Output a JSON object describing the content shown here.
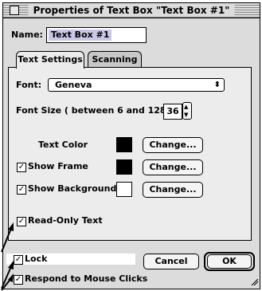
{
  "dialog": {
    "title": "Properties of Text Box \"Text Box #1\"",
    "name_label": "Name:",
    "name_value": "Text Box #1"
  },
  "tabs": [
    {
      "label": "Text Settings",
      "active": true
    },
    {
      "label": "Scanning",
      "active": false
    }
  ],
  "text_settings": {
    "font_label": "Font:",
    "font_value": "Geneva",
    "font_size_label": "Font Size ( between 6 and 128 ):",
    "font_size_value": "36",
    "text_color_label": "Text Color",
    "text_color_swatch": "#000000",
    "show_frame_label": "Show Frame",
    "show_frame_checked": true,
    "frame_color_swatch": "#000000",
    "show_background_label": "Show Background",
    "show_background_checked": true,
    "background_color_swatch": "#ffffff",
    "read_only_label": "Read-Only Text",
    "read_only_checked": true,
    "change_button_label": "Change..."
  },
  "footer": {
    "lock_label": "Lock",
    "lock_checked": true,
    "respond_label": "Respond to Mouse Clicks",
    "respond_checked": true,
    "cancel_label": "Cancel",
    "ok_label": "OK"
  },
  "icons": {
    "checkmark": "✓",
    "popup_arrow": "⬍",
    "stepper_up": "▲",
    "stepper_down": "▼"
  }
}
